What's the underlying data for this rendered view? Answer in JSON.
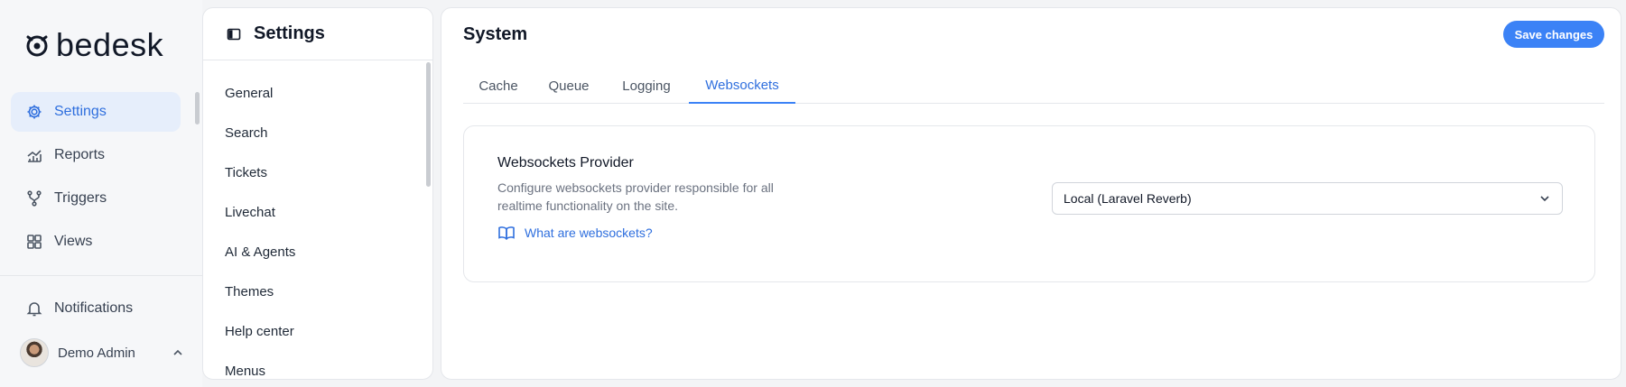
{
  "app": {
    "brand": "bedesk"
  },
  "nav": {
    "items": [
      {
        "label": "Settings",
        "icon": "gear-icon",
        "active": true
      },
      {
        "label": "Reports",
        "icon": "chart-icon",
        "active": false
      },
      {
        "label": "Triggers",
        "icon": "branch-icon",
        "active": false
      },
      {
        "label": "Views",
        "icon": "grid-icon",
        "active": false
      }
    ],
    "notifications": "Notifications",
    "user_name": "Demo Admin"
  },
  "settings": {
    "title": "Settings",
    "items": [
      "General",
      "Search",
      "Tickets",
      "Livechat",
      "AI & Agents",
      "Themes",
      "Help center",
      "Menus"
    ]
  },
  "main": {
    "title": "System",
    "save_label": "Save changes",
    "tabs": [
      {
        "label": "Cache",
        "active": false
      },
      {
        "label": "Queue",
        "active": false
      },
      {
        "label": "Logging",
        "active": false
      },
      {
        "label": "Websockets",
        "active": true
      }
    ],
    "card": {
      "title": "Websockets Provider",
      "description": "Configure websockets provider responsible for all realtime functionality on the site.",
      "link": "What are websockets?",
      "select_value": "Local (Laravel Reverb)"
    }
  },
  "colors": {
    "accent": "#3b82f6",
    "active_bg": "#e6eefb",
    "link": "#2f6fde"
  }
}
